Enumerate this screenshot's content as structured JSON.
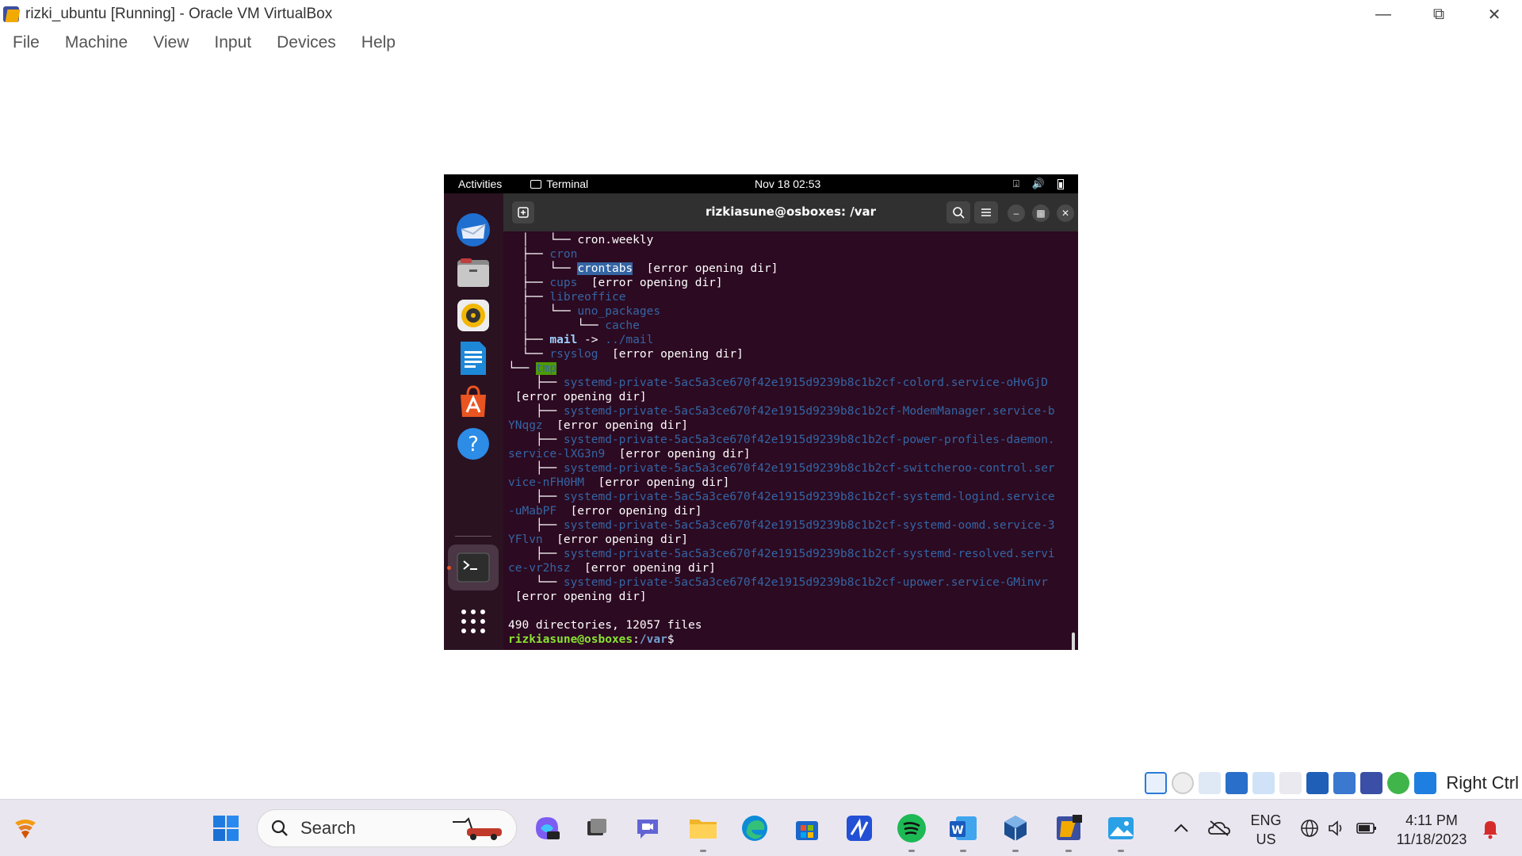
{
  "window": {
    "title": "rizki_ubuntu [Running] - Oracle VM VirtualBox",
    "menu": [
      "File",
      "Machine",
      "View",
      "Input",
      "Devices",
      "Help"
    ]
  },
  "guest": {
    "topbar": {
      "activities": "Activities",
      "app": "Terminal",
      "clock": "Nov 18  02:53"
    },
    "dock_icons": [
      "thunderbird-icon",
      "files-icon",
      "rhythmbox-icon",
      "writer-icon",
      "app-center-icon",
      "help-icon",
      "terminal-icon",
      "show-apps-icon"
    ],
    "terminal": {
      "title": "rizkiasune@osboxes: /var",
      "lines": {
        "l1_tree": "  │   └── ",
        "l1_name": "cron.weekly",
        "l2_tree": "  ├── ",
        "l2_name": "cron",
        "l3_tree": "  │   └── ",
        "l3_name": "crontabs",
        "l3_err": "  [error opening dir]",
        "l4_tree": "  ├── ",
        "l4_name": "cups",
        "l4_err": "  [error opening dir]",
        "l5_tree": "  ├── ",
        "l5_name": "libreoffice",
        "l6_tree": "  │   └── ",
        "l6_name": "uno_packages",
        "l7_tree": "  │       └── ",
        "l7_name": "cache",
        "l8_tree": "  ├── ",
        "l8_name": "mail",
        "l8_arrow": " -> ",
        "l8_target": "../mail",
        "l9_tree": "  └── ",
        "l9_name": "rsyslog",
        "l9_err": "  [error opening dir]",
        "l10_tree": "└── ",
        "l10_name": "tmp",
        "l11_tree": "    ├── ",
        "l11_name": "systemd-private-5ac5a3ce670f42e1915d9239b8c1b2cf-colord.service-oHvGjD",
        "l12_err": " [error opening dir]",
        "l13_tree": "    ├── ",
        "l13_name": "systemd-private-5ac5a3ce670f42e1915d9239b8c1b2cf-ModemManager.service-b",
        "l14_name": "YNqgz",
        "l14_err": "  [error opening dir]",
        "l15_tree": "    ├── ",
        "l15_name": "systemd-private-5ac5a3ce670f42e1915d9239b8c1b2cf-power-profiles-daemon.",
        "l16_name": "service-lXG3n9",
        "l16_err": "  [error opening dir]",
        "l17_tree": "    ├── ",
        "l17_name": "systemd-private-5ac5a3ce670f42e1915d9239b8c1b2cf-switcheroo-control.ser",
        "l18_name": "vice-nFH0HM",
        "l18_err": "  [error opening dir]",
        "l19_tree": "    ├── ",
        "l19_name": "systemd-private-5ac5a3ce670f42e1915d9239b8c1b2cf-systemd-logind.service",
        "l20_name": "-uMabPF",
        "l20_err": "  [error opening dir]",
        "l21_tree": "    ├── ",
        "l21_name": "systemd-private-5ac5a3ce670f42e1915d9239b8c1b2cf-systemd-oomd.service-3",
        "l22_name": "YFlvn",
        "l22_err": "  [error opening dir]",
        "l23_tree": "    ├── ",
        "l23_name": "systemd-private-5ac5a3ce670f42e1915d9239b8c1b2cf-systemd-resolved.servi",
        "l24_name": "ce-vr2hsz",
        "l24_err": "  [error opening dir]",
        "l25_tree": "    └── ",
        "l25_name": "systemd-private-5ac5a3ce670f42e1915d9239b8c1b2cf-upower.service-GMinvr",
        "l26_err": " [error opening dir]",
        "summary": "490 directories, 12057 files",
        "prompt_user": "rizkiasune@osboxes",
        "prompt_sep": ":",
        "prompt_path": "/var",
        "prompt_end": "$ "
      }
    }
  },
  "statusbar": {
    "host_key": "Right Ctrl"
  },
  "taskbar": {
    "search_placeholder": "Search",
    "lang_top": "ENG",
    "lang_bottom": "US",
    "time": "4:11 PM",
    "date": "11/18/2023"
  },
  "colors": {
    "terminal_bg": "#2c0a21",
    "accent": "#e95420",
    "dir_blue": "#3465a4",
    "prompt_green": "#8ae234"
  }
}
